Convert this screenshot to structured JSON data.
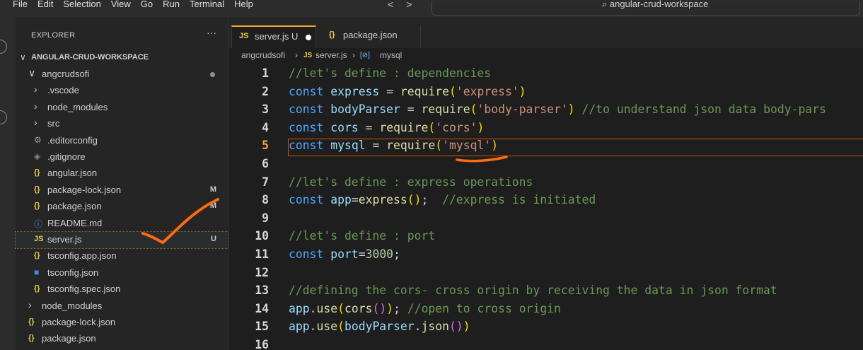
{
  "menu": [
    "File",
    "Edit",
    "Selection",
    "View",
    "Go",
    "Run",
    "Terminal",
    "Help"
  ],
  "search": {
    "text": "angular-crud-workspace"
  },
  "explorer": {
    "header": "EXPLORER",
    "more": "···",
    "workspace": "ANGULAR-CRUD-WORKSPACE",
    "tree": [
      {
        "label": "angcrudsofi",
        "kind": "folder-open",
        "badge": "",
        "dot": true
      },
      {
        "label": ".vscode",
        "kind": "folder",
        "badge": ""
      },
      {
        "label": "node_modules",
        "kind": "folder",
        "badge": ""
      },
      {
        "label": "src",
        "kind": "folder",
        "badge": ""
      },
      {
        "label": ".editorconfig",
        "kind": "gear",
        "badge": ""
      },
      {
        "label": ".gitignore",
        "kind": "git",
        "badge": ""
      },
      {
        "label": "angular.json",
        "kind": "json",
        "badge": ""
      },
      {
        "label": "package-lock.json",
        "kind": "json",
        "badge": "M"
      },
      {
        "label": "package.json",
        "kind": "json",
        "badge": "M"
      },
      {
        "label": "README.md",
        "kind": "info",
        "badge": ""
      },
      {
        "label": "server.js",
        "kind": "js",
        "badge": "U",
        "selected": true
      },
      {
        "label": "tsconfig.app.json",
        "kind": "json",
        "badge": ""
      },
      {
        "label": "tsconfig.json",
        "kind": "ts",
        "badge": ""
      },
      {
        "label": "tsconfig.spec.json",
        "kind": "json",
        "badge": ""
      },
      {
        "label": "node_modules",
        "kind": "folder",
        "badge": ""
      },
      {
        "label": "package-lock.json",
        "kind": "json",
        "badge": ""
      },
      {
        "label": "package.json",
        "kind": "json",
        "badge": ""
      }
    ]
  },
  "tabs": [
    {
      "icon": "JS",
      "label": "server.js U",
      "active": true,
      "dirty": true
    },
    {
      "icon": "{}",
      "label": "package.json",
      "active": false
    }
  ],
  "breadcrumb": {
    "folder": "angcrudsofi",
    "file_icon": "JS",
    "file": "server.js",
    "symbol_icon": "[⊘]",
    "symbol": "mysql"
  },
  "code": [
    {
      "n": "1",
      "text": "//let's define : dependencies"
    },
    {
      "n": "2",
      "text": "const express = require('express')"
    },
    {
      "n": "3",
      "text": "const bodyParser = require('body-parser') //to understand json data body-pars"
    },
    {
      "n": "4",
      "text": "const cors = require('cors')"
    },
    {
      "n": "5",
      "text": "const mysql = require('mysql')"
    },
    {
      "n": "6",
      "text": ""
    },
    {
      "n": "7",
      "text": "//let's define : express operations"
    },
    {
      "n": "8",
      "text": "const app=express();  //express is initiated"
    },
    {
      "n": "9",
      "text": ""
    },
    {
      "n": "10",
      "text": "//let's define : port"
    },
    {
      "n": "11",
      "text": "const port=3000;"
    },
    {
      "n": "12",
      "text": ""
    },
    {
      "n": "13",
      "text": "//defining the cors- cross origin by receiving the data in json format"
    },
    {
      "n": "14",
      "text": "app.use(cors()); //open to cross origin"
    },
    {
      "n": "15",
      "text": "app.use(bodyParser.json())"
    },
    {
      "n": "16",
      "text": ""
    }
  ],
  "current_line": "5",
  "colors": {
    "accent": "#f0a830",
    "annotation": "#ff6a13",
    "keyword": "#4fa6ff",
    "variable": "#9cdcfe",
    "function": "#dcdcaa",
    "string": "#ce9178",
    "comment": "#6a9955"
  }
}
